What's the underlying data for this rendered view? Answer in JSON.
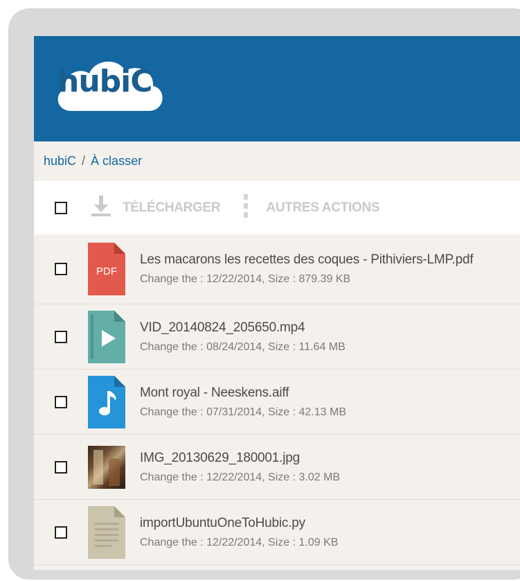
{
  "app": {
    "logo_text": "hubiC"
  },
  "breadcrumb": {
    "root": "hubiC",
    "separator": "/",
    "current": "À classer"
  },
  "toolbar": {
    "download_label": "TÉLÉCHARGER",
    "more_actions_label": "AUTRES ACTIONS"
  },
  "colors": {
    "header_bg": "#1467a0",
    "pdf": "#e25a4b",
    "video": "#63aea8",
    "audio": "#2594d8",
    "text_file": "#cbc4ac"
  },
  "files": [
    {
      "name": "Les macarons les recettes des coques - Pithiviers-LMP.pdf",
      "meta": "Change the : 12/22/2014, Size : 879.39 KB",
      "icon": "pdf-icon",
      "icon_label": "PDF"
    },
    {
      "name": "VID_20140824_205650.mp4",
      "meta": "Change the : 08/24/2014, Size : 11.64 MB",
      "icon": "video-file-icon"
    },
    {
      "name": "Mont royal - Neeskens.aiff",
      "meta": "Change the : 07/31/2014, Size : 42.13 MB",
      "icon": "audio-file-icon"
    },
    {
      "name": "IMG_20130629_180001.jpg",
      "meta": "Change the : 12/22/2014, Size : 3.02 MB",
      "icon": "image-thumbnail"
    },
    {
      "name": "importUbuntuOneToHubic.py",
      "meta": "Change the : 12/22/2014, Size : 1.09 KB",
      "icon": "text-file-icon"
    }
  ]
}
